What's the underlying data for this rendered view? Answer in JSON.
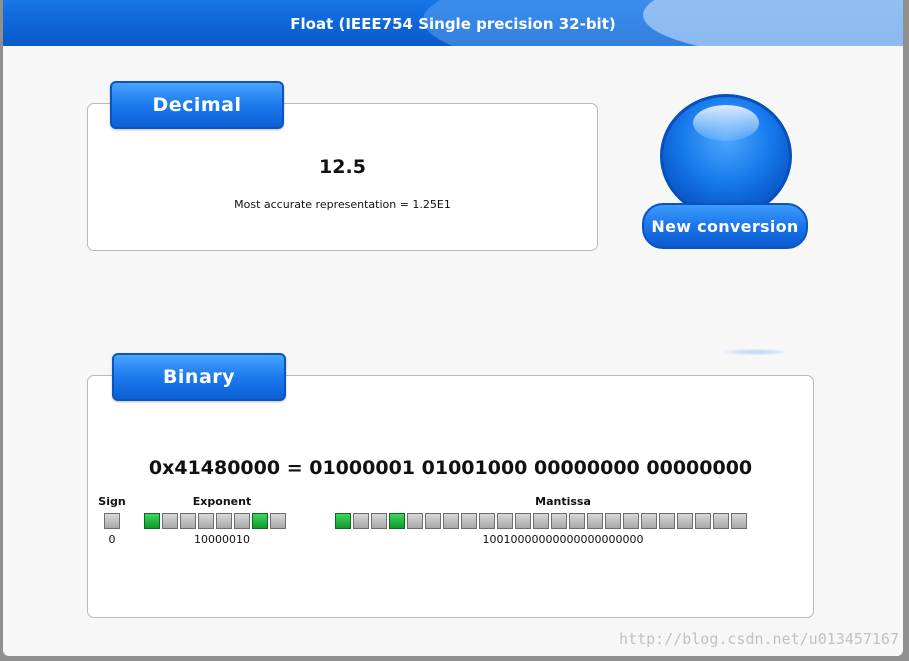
{
  "window": {
    "title": "Float (IEEE754 Single precision 32-bit)"
  },
  "decimal": {
    "tab_label": "Decimal",
    "value": "12.5",
    "accurate": "Most accurate representation = 1.25E1"
  },
  "new_conversion": {
    "label": "New conversion"
  },
  "binary": {
    "tab_label": "Binary",
    "hex_line": "0x41480000 = 01000001 01001000 00000000 00000000",
    "sign": {
      "label": "Sign",
      "value": "0",
      "bits": [
        0
      ]
    },
    "exponent": {
      "label": "Exponent",
      "value": "10000010",
      "bits": [
        1,
        0,
        0,
        0,
        0,
        0,
        1,
        0
      ]
    },
    "mantissa": {
      "label": "Mantissa",
      "value": "10010000000000000000000",
      "bits": [
        1,
        0,
        0,
        1,
        0,
        0,
        0,
        0,
        0,
        0,
        0,
        0,
        0,
        0,
        0,
        0,
        0,
        0,
        0,
        0,
        0,
        0,
        0
      ]
    }
  },
  "watermark": "http://blog.csdn.net/u013457167",
  "colors": {
    "accent": "#0d63d6",
    "bit_on": "#1fb43a",
    "bit_off": "#bdbdbd"
  }
}
